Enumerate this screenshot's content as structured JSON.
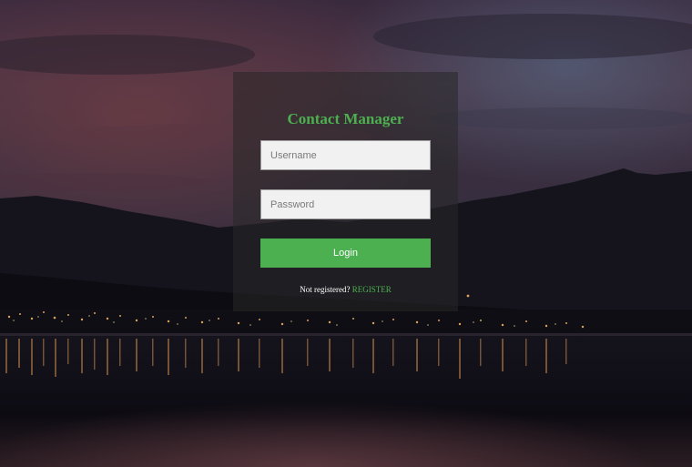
{
  "app": {
    "title": "Contact Manager"
  },
  "form": {
    "username": {
      "placeholder": "Username",
      "value": ""
    },
    "password": {
      "placeholder": "Password",
      "value": ""
    },
    "login_label": "Login"
  },
  "register": {
    "prompt": "Not registered?",
    "link_label": "REGISTER"
  },
  "colors": {
    "accent": "#4caf50",
    "card_bg": "rgba(40,40,40,0.55)",
    "field_bg": "#f1f1f1",
    "text_light": "#ffffff"
  }
}
